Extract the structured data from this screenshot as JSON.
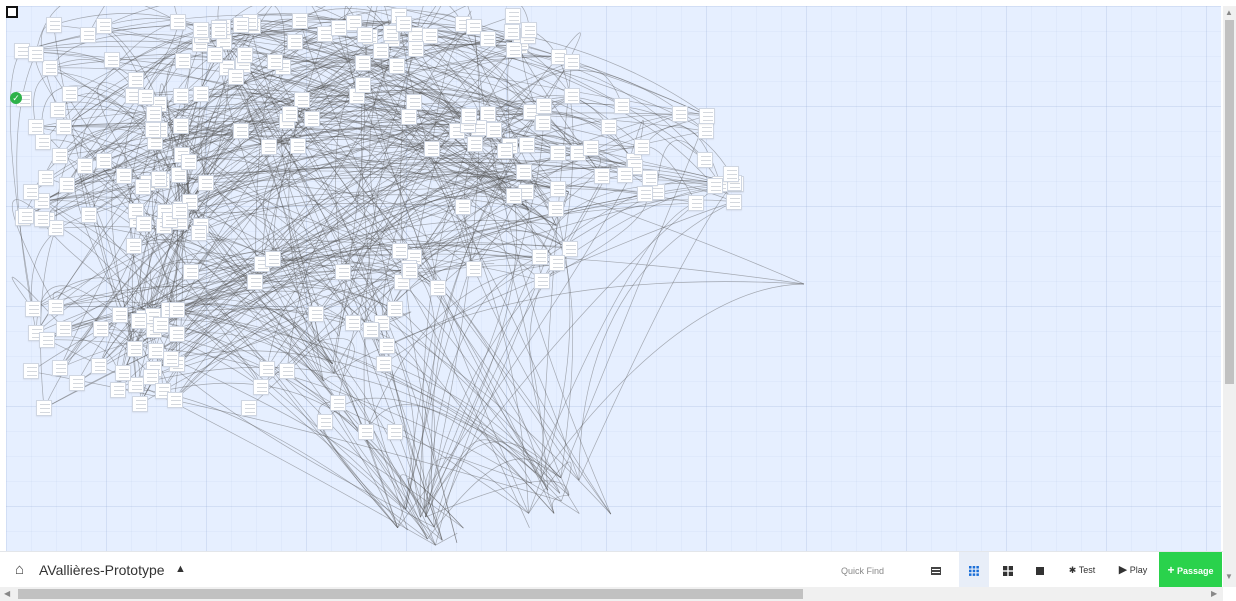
{
  "story": {
    "title": "AVallières-Prototype"
  },
  "toolbar": {
    "quick_find_placeholder": "Quick Find",
    "test_label": "Test",
    "play_label": "Play",
    "add_passage_label": "Passage",
    "test_glyph": "✱",
    "play_glyph": "▶",
    "add_glyph": "+",
    "caret": "▲",
    "home_glyph": "⌂"
  },
  "icons": {
    "home": "home-icon",
    "story_details": "list-icon",
    "zoom_small": "grid-9-icon",
    "zoom_medium": "grid-4-icon",
    "zoom_large": "square-icon",
    "test": "bug-icon",
    "play": "play-icon",
    "add": "plus-icon"
  },
  "colors": {
    "canvas": "#e6efff",
    "passage_border": "#cfd6e2",
    "link": "#555555",
    "accent": "#1b6fd8",
    "add_button": "#2ad24c",
    "start_badge": "#2eb24a"
  },
  "passage_count": 230
}
